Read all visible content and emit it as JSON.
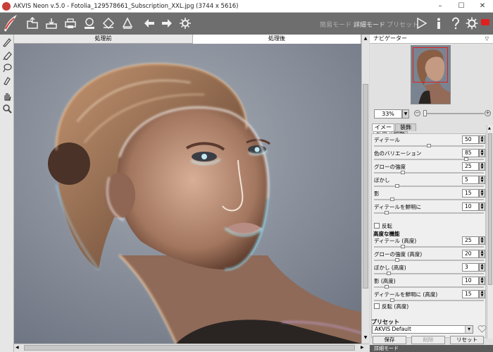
{
  "window": {
    "title": "AKVIS Neon v.5.0 - Fotolia_129578661_Subscription_XXL.jpg (3744 x 5616)",
    "minimize": "–",
    "maximize": "☐",
    "close": "✕"
  },
  "toolbar": {
    "icons": [
      "open-icon",
      "save-icon",
      "print-icon",
      "share-icon",
      "batch-icon",
      "plugin-icon",
      "back-icon",
      "forward-icon",
      "settings-gear-icon"
    ],
    "mode_express": "簡易モード",
    "mode_advanced": "詳細モード",
    "mode_preset": "プリセット"
  },
  "view_tabs": {
    "before": "処理前",
    "after": "処理後"
  },
  "navigator": {
    "title": "ナビゲーター",
    "zoom": "33%",
    "zoom_minus": "−",
    "zoom_plus": "+"
  },
  "panel_tabs": {
    "image": "イメージ",
    "decoration": "装飾"
  },
  "effect_tabs": {
    "effect": "効果",
    "adjust": "調整"
  },
  "params": [
    {
      "label": "ディテール",
      "value": "50",
      "pos": 0.5
    },
    {
      "label": "色のバリエーション",
      "value": "85",
      "pos": 0.85
    },
    {
      "label": "グローの強度",
      "value": "25",
      "pos": 0.25
    },
    {
      "label": "ぼかし",
      "value": "5",
      "pos": 0.2
    },
    {
      "label": "影",
      "value": "15",
      "pos": 0.15
    },
    {
      "label": "ディテールを鮮明に",
      "value": "10",
      "pos": 0.1
    }
  ],
  "invert_label": "反転",
  "advanced_title": "高度な機能",
  "advanced_params": [
    {
      "label": "ディテール (高度)",
      "value": "25",
      "pos": 0.25
    },
    {
      "label": "グローの強度 (高度)",
      "value": "20",
      "pos": 0.2
    },
    {
      "label": "ぼかし (高度)",
      "value": "3",
      "pos": 0.12
    },
    {
      "label": "影 (高度)",
      "value": "10",
      "pos": 0.1
    },
    {
      "label": "ディテールを鮮明に (高度)",
      "value": "15",
      "pos": 0.15
    }
  ],
  "invert_advanced_label": "反転 (高度)",
  "presets": {
    "title": "プリセット",
    "selected": "AKVIS Default",
    "save": "保存",
    "delete": "削除",
    "reset": "リセット"
  },
  "help_strip": "詳細モード",
  "colors": {
    "toolbar": "#6e6e6e",
    "accent_close": "#e0201f"
  }
}
